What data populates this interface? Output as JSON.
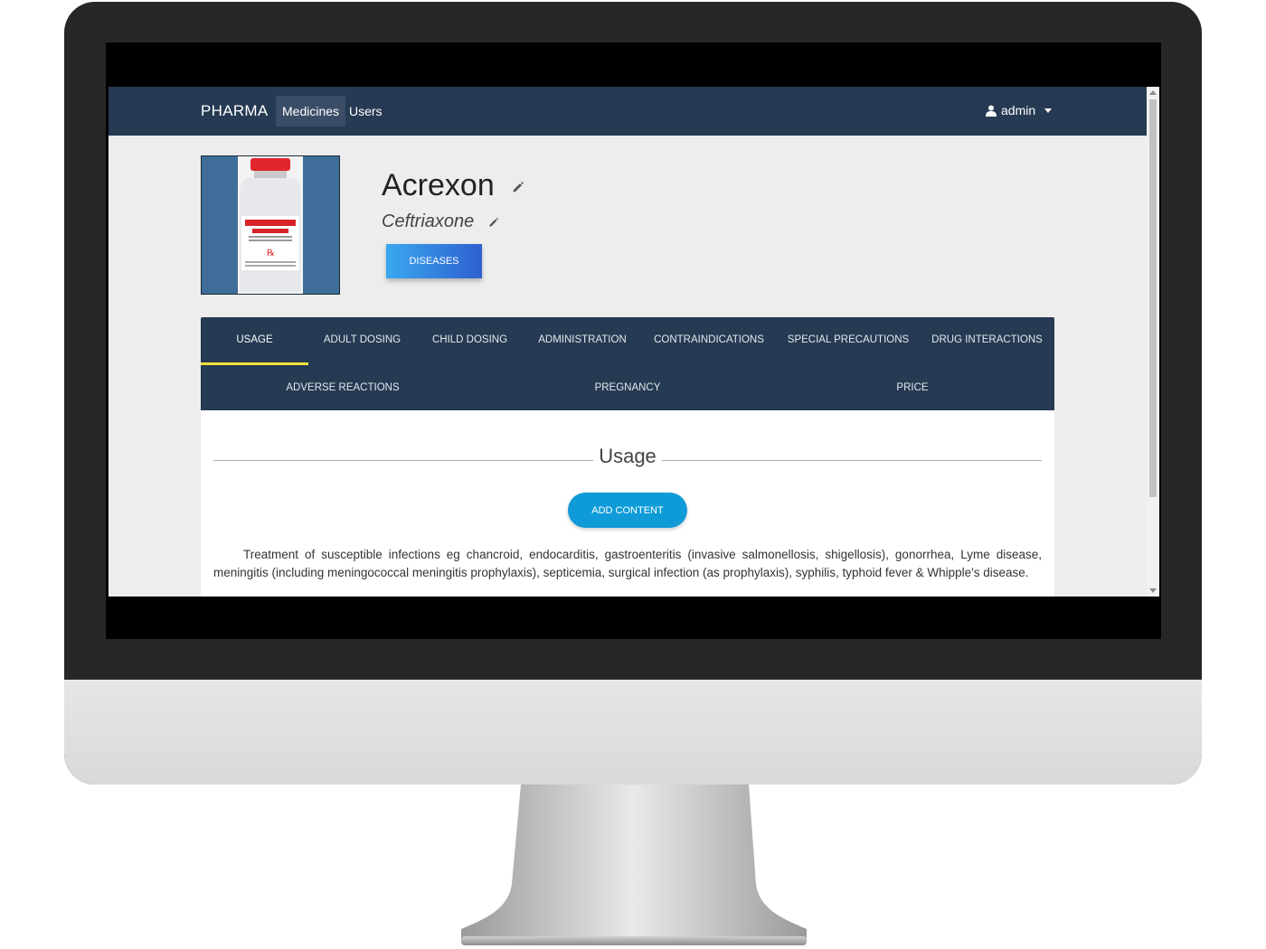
{
  "navbar": {
    "brand": "PHARMA",
    "items": [
      {
        "label": "Medicines",
        "active": true
      },
      {
        "label": "Users",
        "active": false
      }
    ],
    "user": {
      "icon": "user-icon",
      "name": "admin"
    }
  },
  "medicine": {
    "name": "Acrexon",
    "generic": "Ceftriaxone",
    "diseases_button": "DISEASES",
    "image_icon": "medicine-vial-image"
  },
  "tabs": [
    {
      "label": "USAGE",
      "active": true
    },
    {
      "label": "ADULT DOSING"
    },
    {
      "label": "CHILD DOSING"
    },
    {
      "label": "ADMINISTRATION"
    },
    {
      "label": "CONTRAINDICATIONS"
    },
    {
      "label": "SPECIAL PRECAUTIONS"
    },
    {
      "label": "DRUG INTERACTIONS"
    },
    {
      "label": "ADVERSE REACTIONS"
    },
    {
      "label": "PREGNANCY"
    },
    {
      "label": "PRICE"
    }
  ],
  "section": {
    "title": "Usage",
    "add_button": "ADD CONTENT",
    "content": "Treatment of susceptible infections eg chancroid, endocarditis, gastroenteritis (invasive salmonellosis, shigellosis), gonorrhea, Lyme disease, meningitis (including meningococcal meningitis prophylaxis), septicemia, surgical infection (as prophylaxis), syphilis, typhoid fever & Whipple's disease."
  },
  "colors": {
    "navbar": "#263a53",
    "tab_indicator": "#f1e23c",
    "add_button": "#0f9bd7",
    "page_bg": "#ededed"
  }
}
